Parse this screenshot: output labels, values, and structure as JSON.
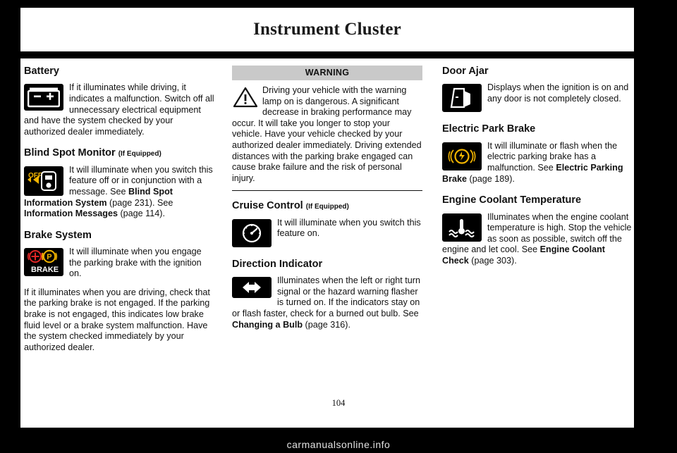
{
  "header": {
    "title": "Instrument Cluster"
  },
  "page_number": "104",
  "watermark": "carmanualsonline.info",
  "column1": {
    "battery": {
      "heading": "Battery",
      "icon": "battery-icon",
      "text_html": "If it illuminates while driving, it indicates a malfunction. Switch off all unnecessary electrical equipment and have the system checked by your authorized dealer immediately."
    },
    "blind_spot": {
      "heading": "Blind Spot Monitor",
      "heading_note": "(If Equipped)",
      "icon": "blind-spot-off-icon",
      "text_plain": "It will illuminate when you switch this feature off or in conjunction with a message.  See ",
      "ref1": "Blind Spot Information System",
      "ref1_page": " (page 231).    See ",
      "ref2": "Information Messages",
      "ref2_page": " (page 114)."
    },
    "brake_system": {
      "heading": "Brake System",
      "icon": "brake-system-icon",
      "text1": "It will illuminate when you engage the parking brake with the ignition on.",
      "text2": "If it illuminates when you are driving, check that the parking brake is not engaged. If the parking brake is not engaged, this indicates low brake fluid level or a brake system malfunction. Have the system checked immediately by your authorized dealer."
    }
  },
  "column2": {
    "warning": {
      "label": "WARNING",
      "icon": "warning-triangle-icon",
      "text": "Driving your vehicle with the warning lamp on is dangerous. A significant decrease in braking performance may occur. It will take you longer to stop your vehicle. Have your vehicle checked by your authorized dealer immediately. Driving extended distances with the parking brake engaged can cause brake failure and the risk of personal injury."
    },
    "cruise_control": {
      "heading": "Cruise Control",
      "heading_note": "(If Equipped)",
      "icon": "cruise-control-icon",
      "text": "It will illuminate when you switch this feature on."
    },
    "direction_indicator": {
      "heading": "Direction Indicator",
      "icon": "direction-indicator-icon",
      "text_plain": "Illuminates when the left or right turn signal or the hazard warning flasher is turned on. If the indicators stay on or flash faster, check for a burned out bulb.  See ",
      "ref1": "Changing a Bulb",
      "ref1_page": " (page 316)."
    }
  },
  "column3": {
    "door_ajar": {
      "heading": "Door Ajar",
      "icon": "door-ajar-icon",
      "text": "Displays when the ignition is on and any door is not completely closed."
    },
    "electric_park_brake": {
      "heading": "Electric Park Brake",
      "icon": "electric-park-brake-icon",
      "text_plain": "It will illuminate or flash when the electric parking brake has a malfunction. See ",
      "ref1": "Electric Parking Brake",
      "ref1_page": " (page 189)."
    },
    "engine_coolant": {
      "heading": "Engine Coolant Temperature",
      "icon": "coolant-temp-icon",
      "text_plain": "Illuminates when the engine coolant temperature is high. Stop the vehicle as soon as possible, switch off the engine and let cool. See ",
      "ref1": "Engine Coolant Check",
      "ref1_page": " (page 303)."
    }
  }
}
